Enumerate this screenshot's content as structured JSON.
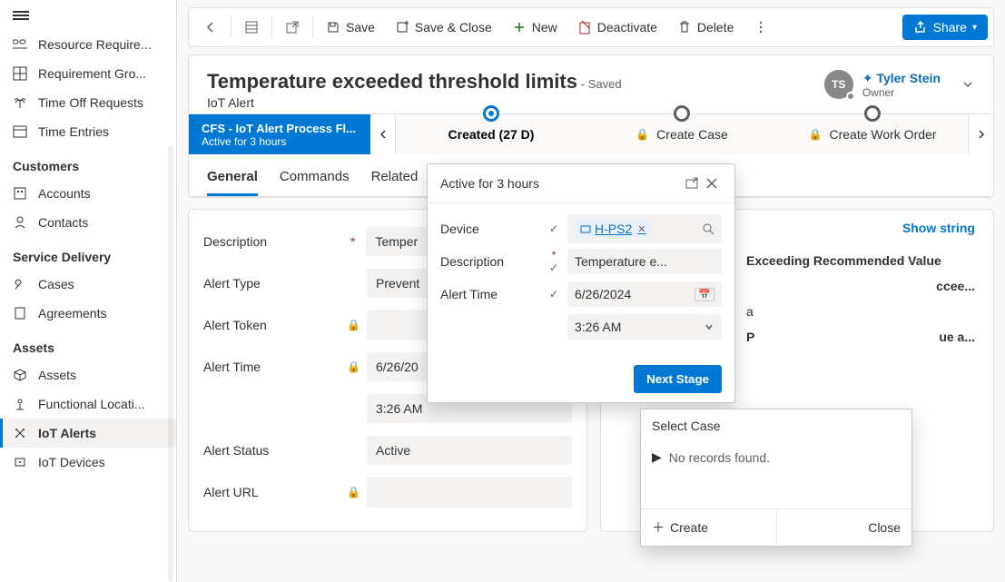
{
  "sidebar": {
    "items": [
      {
        "label": "Resource Require..."
      },
      {
        "label": "Requirement Gro..."
      },
      {
        "label": "Time Off Requests"
      },
      {
        "label": "Time Entries"
      }
    ],
    "customers_header": "Customers",
    "customers": [
      {
        "label": "Accounts"
      },
      {
        "label": "Contacts"
      }
    ],
    "service_header": "Service Delivery",
    "service": [
      {
        "label": "Cases"
      },
      {
        "label": "Agreements"
      }
    ],
    "assets_header": "Assets",
    "assets": [
      {
        "label": "Assets"
      },
      {
        "label": "Functional Locati..."
      },
      {
        "label": "IoT Alerts"
      },
      {
        "label": "IoT Devices"
      }
    ]
  },
  "commands": {
    "save": "Save",
    "save_close": "Save & Close",
    "new": "New",
    "deactivate": "Deactivate",
    "delete": "Delete",
    "share": "Share"
  },
  "record": {
    "title": "Temperature exceeded threshold limits",
    "saved_suffix": "- Saved",
    "type": "IoT Alert",
    "owner_initials": "TS",
    "owner_name": "Tyler Stein",
    "owner_prefix": "✦",
    "owner_role": "Owner"
  },
  "bpf": {
    "process_name": "CFS - IoT Alert Process Fl...",
    "active_text": "Active for 3 hours",
    "stage_created": "Created  (27 D)",
    "stage_case": "Create Case",
    "stage_wo": "Create Work Order"
  },
  "tabs": {
    "general": "General",
    "commands": "Commands",
    "related": "Related"
  },
  "form": {
    "description_label": "Description",
    "description_value": "Temper",
    "alert_type_label": "Alert Type",
    "alert_type_value": "Prevent",
    "alert_token_label": "Alert Token",
    "alert_time_label": "Alert Time",
    "alert_time_date": "6/26/20",
    "alert_time_time": "3:26 AM",
    "alert_status_label": "Alert Status",
    "alert_status_value": "Active",
    "alert_url_label": "Alert URL"
  },
  "right": {
    "show_string": "Show string",
    "heading": "Exceeding Recommended Value",
    "line1": "ccee...",
    "line2": "a",
    "line3": "P",
    "line3b": "ue a..."
  },
  "flyout": {
    "head": "Active for 3 hours",
    "device_label": "Device",
    "device_value": "H-PS2",
    "description_label": "Description",
    "description_value": "Temperature e...",
    "alert_time_label": "Alert Time",
    "alert_time_date": "6/26/2024",
    "alert_time_time": "3:26 AM",
    "next_stage": "Next Stage"
  },
  "lookup": {
    "head": "Select Case",
    "empty": "No records found.",
    "create": "Create",
    "close": "Close"
  }
}
